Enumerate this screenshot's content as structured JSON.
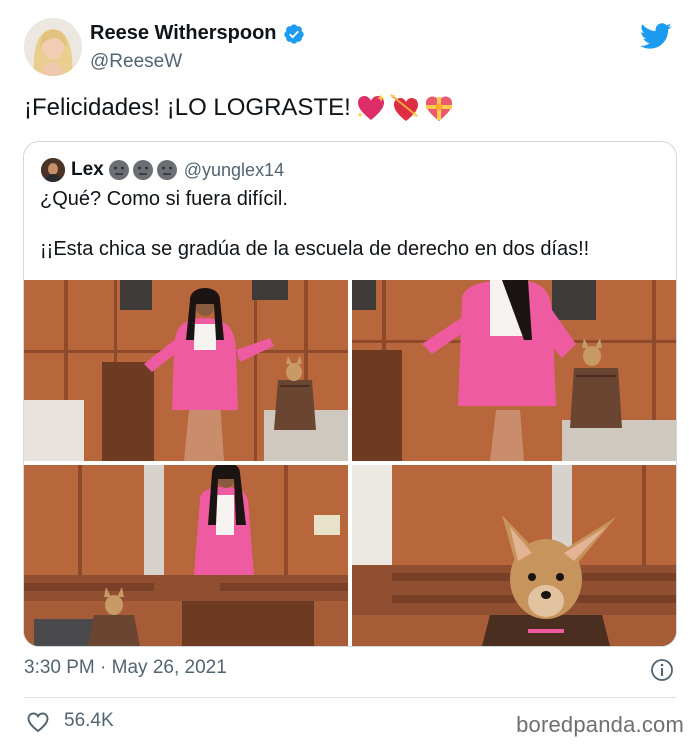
{
  "author": {
    "name": "Reese Witherspoon",
    "handle": "@ReeseW"
  },
  "tweet": {
    "text": "¡Felicidades! ¡LO LOGRASTE!",
    "emojis": [
      "sparkling-heart",
      "heart-with-arrow",
      "heart-with-ribbon"
    ]
  },
  "quoted": {
    "name": "Lex",
    "name_emojis": [
      "neutral-face",
      "neutral-face",
      "neutral-face"
    ],
    "handle": "@yunglex14",
    "line1": "¿Qué? Como si fuera difícil.",
    "line2": "¡¡Esta chica se gradúa de la escuela de derecho en dos días!!"
  },
  "meta": {
    "timestamp": "3:30 PM · May 26, 2021",
    "likes": "56.4K"
  },
  "watermark": "boredpanda.com",
  "colors": {
    "twitter_blue": "#1d9bf0",
    "pink_suit": "#ee5ba0",
    "wood": "#b8663c",
    "text_gray": "#536471"
  }
}
